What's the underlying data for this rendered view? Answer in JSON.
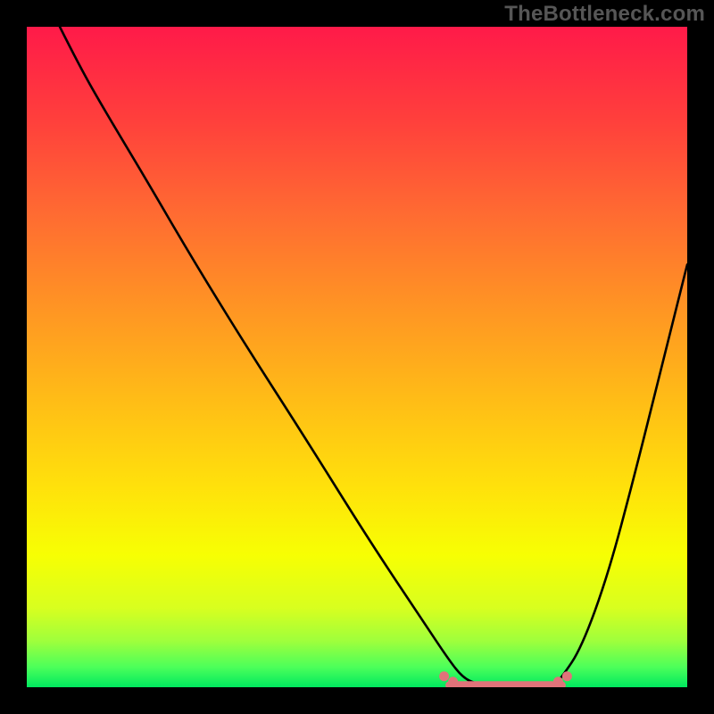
{
  "watermark": "TheBottleneck.com",
  "colors": {
    "background": "#000000",
    "curve": "#000000",
    "trough_marker": "#e0737a",
    "gradient_top": "#ff1a49",
    "gradient_mid": "#ffe20b",
    "gradient_bottom": "#00e85f"
  },
  "chart_data": {
    "type": "line",
    "title": "",
    "xlabel": "",
    "ylabel": "",
    "xlim": [
      0,
      100
    ],
    "ylim": [
      0,
      100
    ],
    "grid": false,
    "legend": false,
    "series": [
      {
        "name": "bottleneck-curve",
        "x": [
          5,
          8,
          12,
          18,
          25,
          33,
          42,
          52,
          60,
          64,
          66,
          68,
          72,
          76,
          80,
          81,
          84,
          88,
          92,
          96,
          100
        ],
        "y": [
          100,
          94,
          87,
          77,
          65,
          52,
          38,
          22,
          10,
          4,
          1.5,
          0.5,
          0,
          0,
          0.5,
          1.5,
          6,
          17,
          32,
          48,
          64
        ]
      }
    ],
    "annotations": [
      {
        "name": "trough-segment",
        "x_start": 64,
        "x_end": 81,
        "y": 0.3,
        "note": "flat minimum region highlighted with pink dots/segment"
      }
    ]
  }
}
